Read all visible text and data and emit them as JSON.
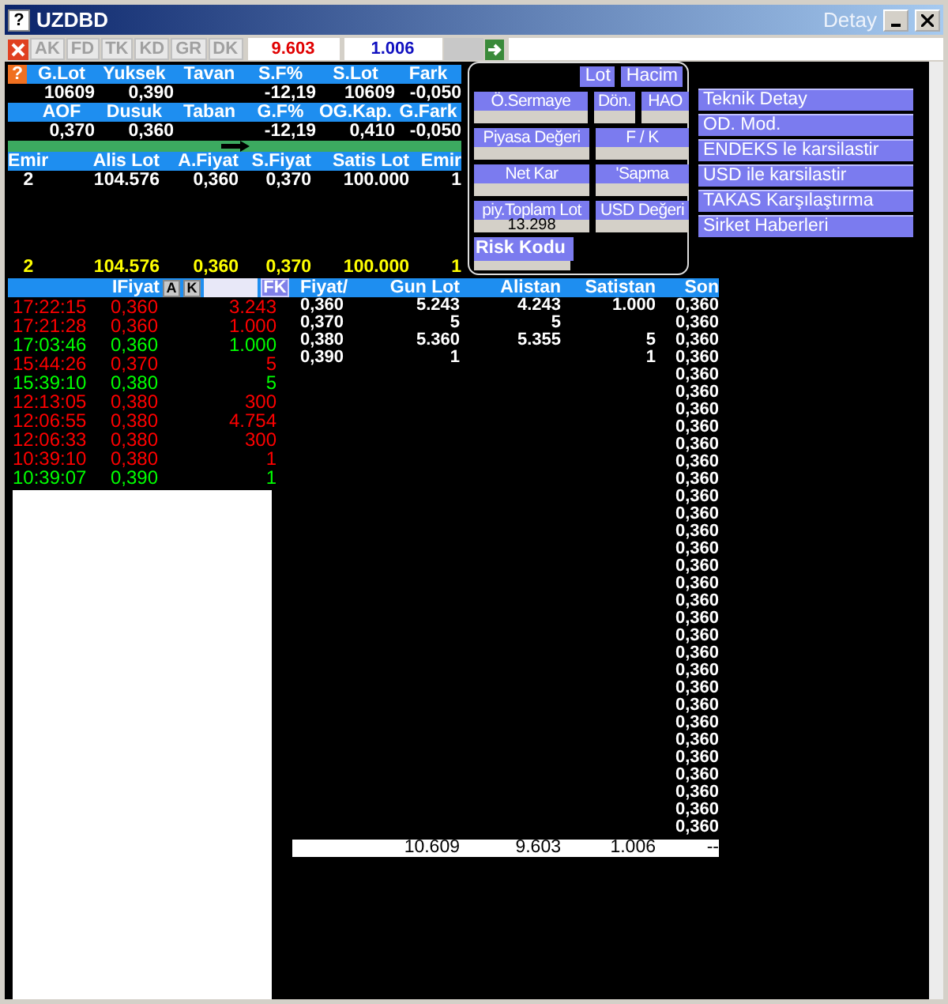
{
  "window": {
    "help": "?",
    "title": "UZDBD",
    "subtitle": "Detay"
  },
  "toolbar": {
    "tabs": [
      {
        "label": "AK",
        "disabled": true
      },
      {
        "label": "FD",
        "disabled": true
      },
      {
        "label": "TK",
        "disabled": true
      },
      {
        "label": "KD",
        "disabled": true
      },
      {
        "label": "GR",
        "disabled": true
      },
      {
        "label": "DK",
        "disabled": true
      }
    ],
    "field_1": "9.603",
    "field_2": "1.006"
  },
  "summary": {
    "help": "?",
    "block_1": [
      {
        "label": "G.Lot",
        "value": "10609"
      },
      {
        "label": "Yuksek",
        "value": "0,390"
      },
      {
        "label": "Tavan"
      },
      {
        "label": "S.F%",
        "value": "-12,19"
      },
      {
        "label": "S.Lot",
        "value": "10609"
      },
      {
        "label": "Fark",
        "value": "-0,050"
      }
    ],
    "block_2": [
      {
        "label": "AOF",
        "value": "0,370"
      },
      {
        "label": "Dusuk",
        "value": "0,360"
      },
      {
        "label": "Taban"
      },
      {
        "label": "G.F%",
        "value": "-12,19"
      },
      {
        "label": "OG.Kap.",
        "value": "0,410"
      },
      {
        "label": "G.Fark",
        "value": "-0,050"
      }
    ]
  },
  "orders": {
    "columns": [
      "Emir",
      "Alis Lot",
      "A.Fiyat",
      "S.Fiyat",
      "Satis Lot",
      "Emir"
    ],
    "row": [
      "2",
      "104.576",
      "0,360",
      "0,370",
      "100.000",
      "1"
    ],
    "total": [
      "2",
      "104.576",
      "0,360",
      "0,370",
      "100.000",
      "1"
    ]
  },
  "trades": {
    "header": "IFiyat",
    "buttons": [
      "A",
      "K"
    ],
    "fk": "FK",
    "rows": [
      {
        "time": "17:22:15",
        "price": "0,360",
        "lot": "3.243",
        "color": "#ff0000"
      },
      {
        "time": "17:21:28",
        "price": "0,360",
        "lot": "1.000",
        "color": "#ff0000"
      },
      {
        "time": "17:03:46",
        "price": "0,360",
        "lot": "1.000",
        "color": "#00ff00"
      },
      {
        "time": "15:44:26",
        "price": "0,370",
        "lot": "5",
        "color": "#ff0000"
      },
      {
        "time": "15:39:10",
        "price": "0,380",
        "lot": "5",
        "color": "#00ff00"
      },
      {
        "time": "12:13:05",
        "price": "0,380",
        "lot": "300",
        "color": "#ff0000"
      },
      {
        "time": "12:06:55",
        "price": "0,380",
        "lot": "4.754",
        "color": "#ff0000"
      },
      {
        "time": "12:06:33",
        "price": "0,380",
        "lot": "300",
        "color": "#ff0000"
      },
      {
        "time": "10:39:10",
        "price": "0,380",
        "lot": "1",
        "color": "#ff0000"
      },
      {
        "time": "10:39:07",
        "price": "0,390",
        "lot": "1",
        "color": "#00ff00"
      }
    ]
  },
  "depth": {
    "columns": [
      "Fiyat/",
      "Gun Lot",
      "Alistan",
      "Satistan",
      "Son"
    ],
    "rows": [
      {
        "fiyat": "0,360",
        "gun_lot": "5.243",
        "alistan": "4.243",
        "satistan": "1.000",
        "son": "0,360"
      },
      {
        "fiyat": "0,370",
        "gun_lot": "5",
        "alistan": "5",
        "son": "0,360"
      },
      {
        "fiyat": "0,380",
        "gun_lot": "5.360",
        "alistan": "5.355",
        "satistan": "5",
        "son": "0,360"
      },
      {
        "fiyat": "0,390",
        "gun_lot": "1",
        "satistan": "1",
        "son": "0,360"
      },
      {
        "son": "0,360"
      },
      {
        "son": "0,360"
      },
      {
        "son": "0,360"
      },
      {
        "son": "0,360"
      },
      {
        "son": "0,360"
      },
      {
        "son": "0,360"
      },
      {
        "son": "0,360"
      },
      {
        "son": "0,360"
      },
      {
        "son": "0,360"
      },
      {
        "son": "0,360"
      },
      {
        "son": "0,360"
      },
      {
        "son": "0,360"
      },
      {
        "son": "0,360"
      },
      {
        "son": "0,360"
      },
      {
        "son": "0,360"
      },
      {
        "son": "0,360"
      },
      {
        "son": "0,360"
      },
      {
        "son": "0,360"
      },
      {
        "son": "0,360"
      },
      {
        "son": "0,360"
      },
      {
        "son": "0,360"
      },
      {
        "son": "0,360"
      },
      {
        "son": "0,360"
      },
      {
        "son": "0,360"
      },
      {
        "son": "0,360"
      },
      {
        "son": "0,360"
      },
      {
        "son": "0,360"
      }
    ],
    "totals": [
      "10.609",
      "9.603",
      "1.006",
      "--"
    ]
  },
  "popup": {
    "buttons": [
      "Lot",
      "Hacim"
    ],
    "rows": [
      [
        {
          "label": "Ö.Sermaye"
        },
        {
          "label": "Dön."
        },
        {
          "label": "HAO"
        }
      ],
      [
        {
          "label": "Piyasa Değeri"
        },
        {
          "label": "F / K"
        }
      ],
      [
        {
          "label": "Net Kar"
        },
        {
          "label": "'Sapma"
        }
      ],
      [
        {
          "label": "piy.Toplam Lot",
          "value": "13.298"
        },
        {
          "label": "USD Değeri"
        }
      ]
    ],
    "risk_label": "Risk Kodu"
  },
  "menu": [
    "Teknik Detay",
    "OD. Mod.",
    "ENDEKS le karsilastir",
    "USD ile karsilastir",
    "TAKAS Karşılaştırma",
    "Sirket Haberleri"
  ]
}
